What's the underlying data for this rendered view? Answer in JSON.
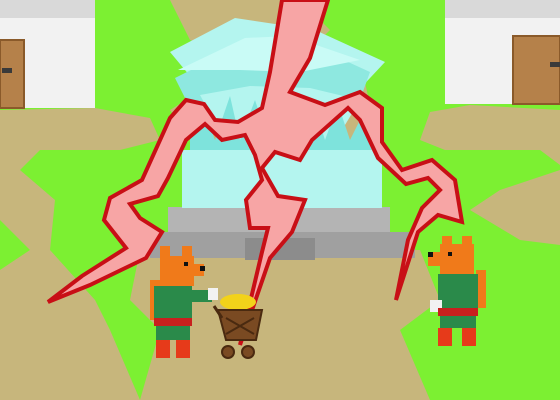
{
  "scene": {
    "kind": "game-cutscene",
    "colors": {
      "grass": "#7cf032",
      "path": "#c7b67c",
      "path_edge": "#9a8a52",
      "house_wall": "#f2f2f2",
      "house_roof": "#d9d9d9",
      "door": "#b5814a",
      "crystal_light": "#b4f5ef",
      "crystal_mid": "#7ee3dc",
      "stone": "#a8a8a8",
      "stone_dark": "#8c8c8c",
      "lightning_fill": "#f7a5a5",
      "lightning_outline": "#c80f16",
      "fox_fur": "#f07a1a",
      "fox_shirt": "#2a8a4a",
      "fox_belt": "#c8201e",
      "fox_boots": "#e63a1a",
      "cart_wood": "#7a4a22",
      "gold": "#f2d21a"
    },
    "characters": [
      {
        "name": "fox-left",
        "facing": "right",
        "pose": "pushing-cart"
      },
      {
        "name": "fox-right",
        "facing": "left",
        "pose": "standing"
      }
    ],
    "objects": [
      "house-left",
      "house-right",
      "crystal-temple",
      "stone-steps",
      "gold-cart",
      "lightning-bolt"
    ]
  }
}
